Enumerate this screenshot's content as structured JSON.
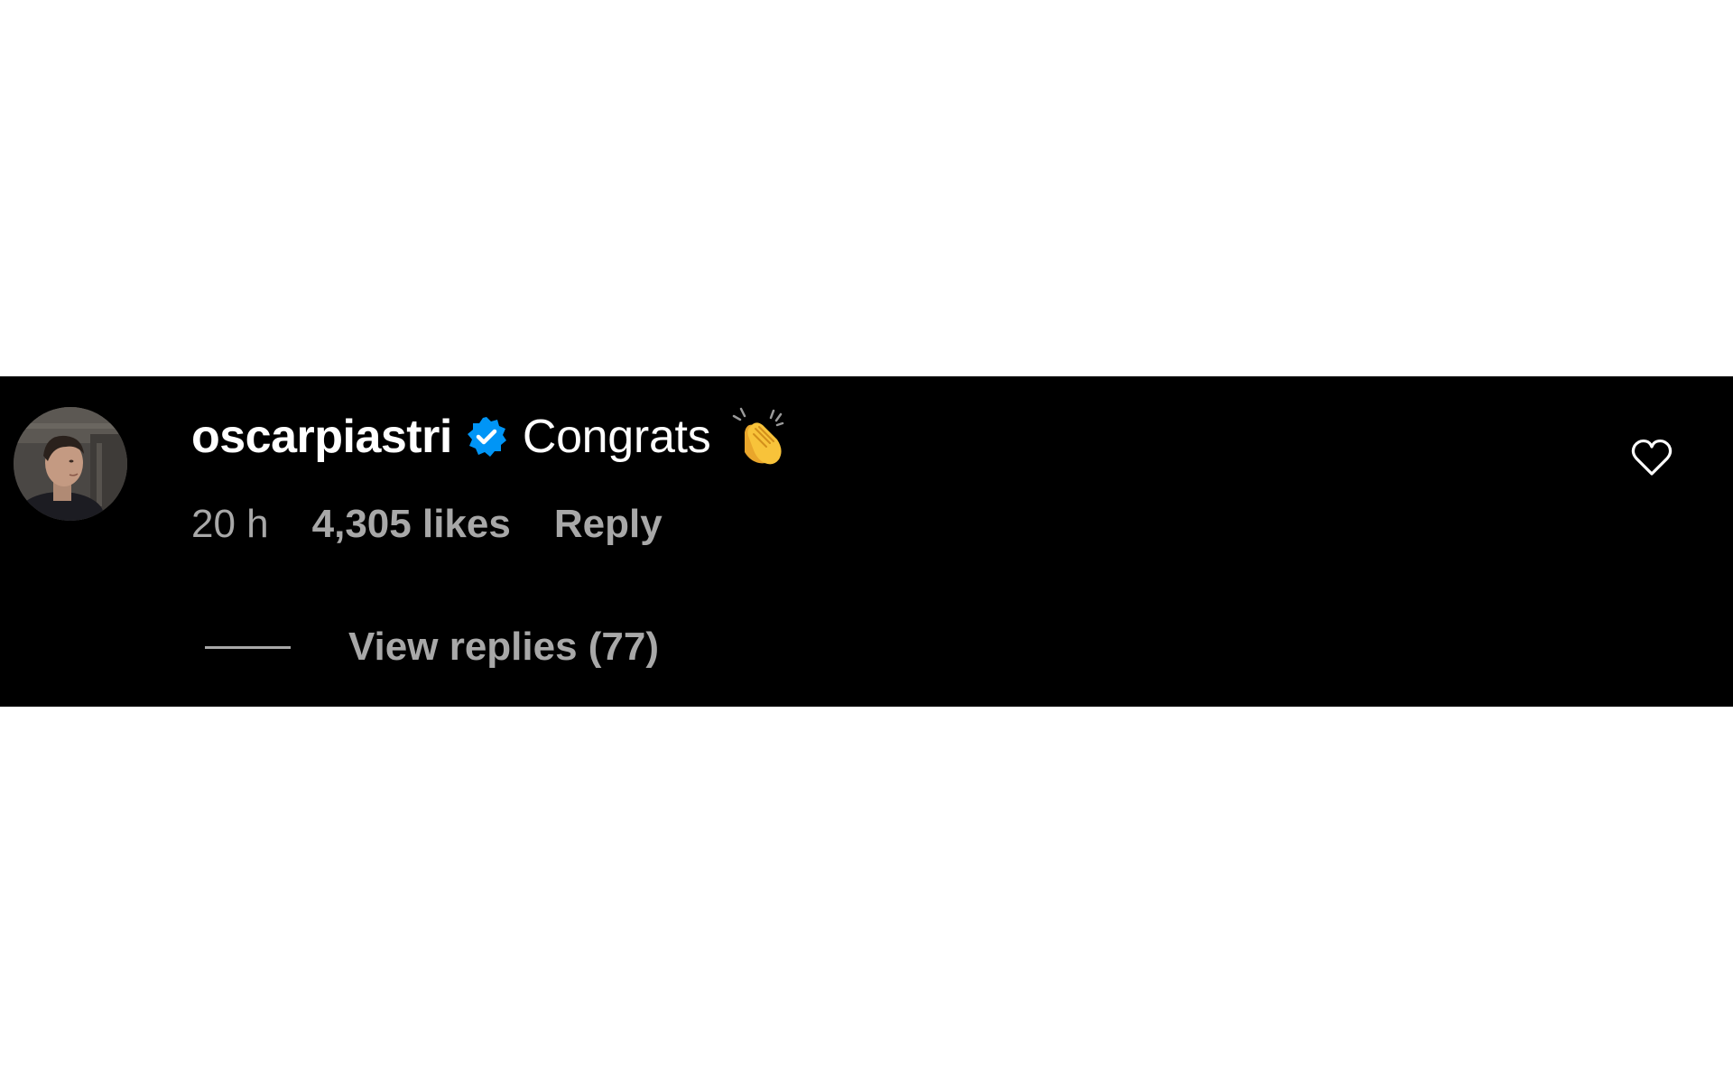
{
  "comment": {
    "username": "oscarpiastri",
    "verified": true,
    "text": "Congrats",
    "emoji_icon": "clapping-hands-icon",
    "time": "20 h",
    "likes": "4,305 likes",
    "reply_label": "Reply",
    "view_replies_label": "View replies (77)",
    "like_icon": "heart-outline-icon"
  },
  "colors": {
    "panel_background": "#000000",
    "page_background": "#ffffff",
    "primary_text": "#ffffff",
    "secondary_text": "#a8a8a8",
    "verified_badge": "#0095f6"
  }
}
